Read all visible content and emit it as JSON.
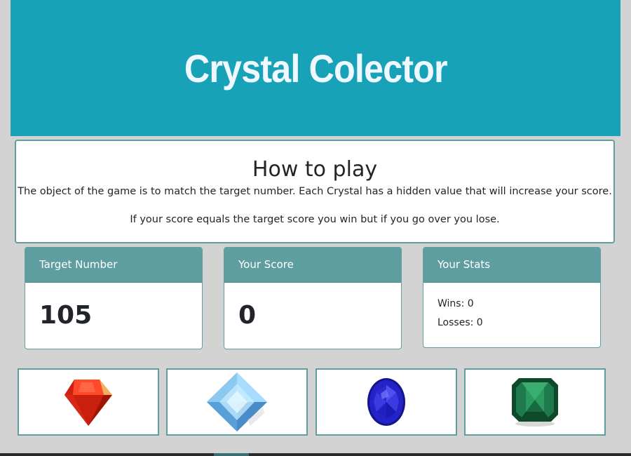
{
  "header": {
    "title": "Crystal Colector"
  },
  "how_to_play": {
    "heading": "How to play",
    "line1": "The object of the game is to match the target number. Each Crystal has a hidden value that will increase your score.",
    "line2": "If your score equals the target score you win but if you go over you lose."
  },
  "target": {
    "label": "Target Number",
    "value": "105"
  },
  "score": {
    "label": "Your Score",
    "value": "0"
  },
  "stats": {
    "label": "Your Stats",
    "wins": "Wins: 0",
    "losses": "Losses: 0"
  },
  "crystals": [
    {
      "name": "red-crystal",
      "color": "#e8321a"
    },
    {
      "name": "blue-crystal",
      "color": "#8cc8f0"
    },
    {
      "name": "sapphire-crystal",
      "color": "#2323c8"
    },
    {
      "name": "green-crystal",
      "color": "#1e7a4a"
    }
  ],
  "colors": {
    "jumbotron": "#17a2b8",
    "card_header": "#5f9ea0",
    "title_text": "#f0f8ff",
    "background": "#d3d3d3"
  }
}
